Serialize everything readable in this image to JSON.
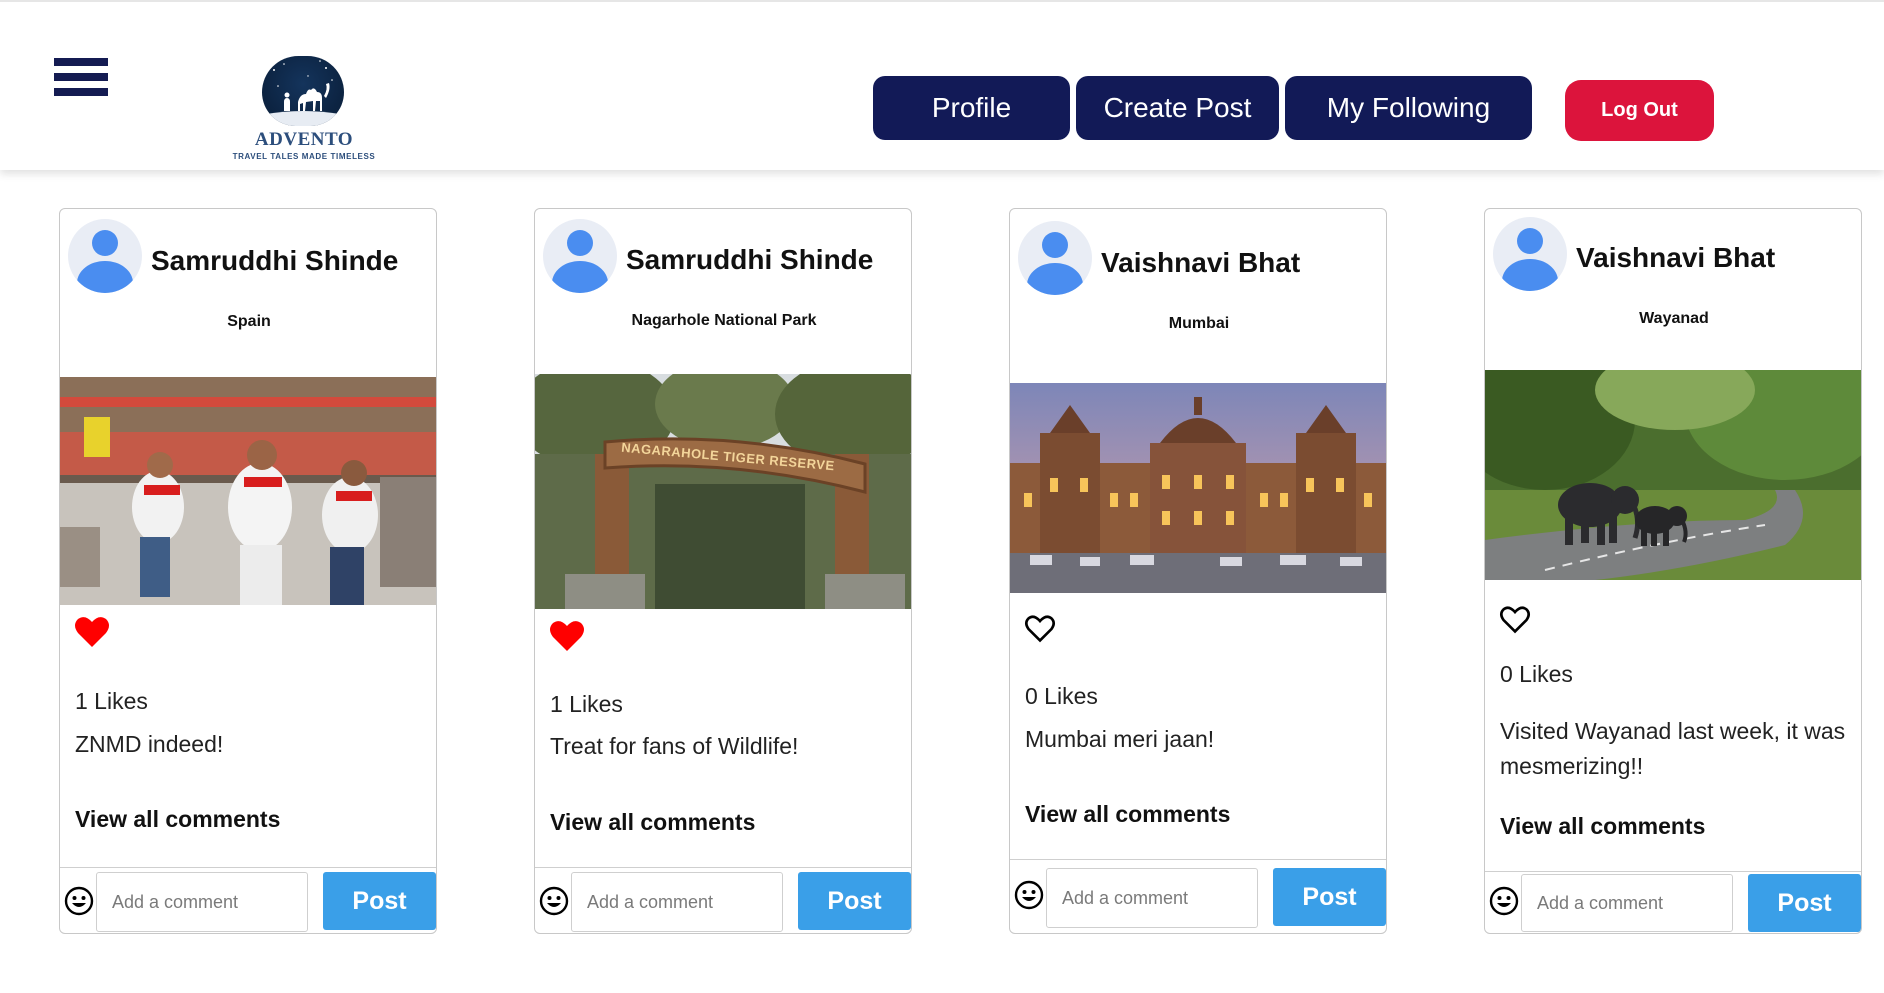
{
  "header": {
    "logo_title": "ADVENTO",
    "logo_tagline": "TRAVEL TALES MADE TIMELESS",
    "nav": {
      "profile": "Profile",
      "create_post": "Create Post",
      "my_following": "My Following"
    },
    "logout": "Log Out"
  },
  "colors": {
    "nav_bg": "#121a57",
    "logout_bg": "#dc143c",
    "post_btn_bg": "#3a9fe8",
    "heart_liked": "#ff0000",
    "avatar_blue": "#4a8df0"
  },
  "posts": [
    {
      "username": "Samruddhi Shinde",
      "location": "Spain",
      "image": "running-of-the-bulls-photo",
      "liked": true,
      "likes_text": "1 Likes",
      "caption": "ZNMD indeed!",
      "view_comments": "View all comments",
      "comment_placeholder": "Add a comment",
      "post_label": "Post"
    },
    {
      "username": "Samruddhi Shinde",
      "location": "Nagarhole National Park",
      "image": "nagarhole-gate-photo",
      "gate_sign": "NAGARAHOLE TIGER RESERVE",
      "liked": true,
      "likes_text": "1 Likes",
      "caption": "Treat for fans of Wildlife!",
      "view_comments": "View all comments",
      "comment_placeholder": "Add a comment",
      "post_label": "Post"
    },
    {
      "username": "Vaishnavi Bhat",
      "location": "Mumbai",
      "image": "cst-station-photo",
      "liked": false,
      "likes_text": "0 Likes",
      "caption": "Mumbai meri jaan!",
      "view_comments": "View all comments",
      "comment_placeholder": "Add a comment",
      "post_label": "Post"
    },
    {
      "username": "Vaishnavi Bhat",
      "location": "Wayanad",
      "image": "elephants-crossing-road-photo",
      "liked": false,
      "likes_text": "0 Likes",
      "caption": "Visited Wayanad last week, it was mesmerizing!!",
      "view_comments": "View all comments",
      "comment_placeholder": "Add a comment",
      "post_label": "Post"
    }
  ]
}
